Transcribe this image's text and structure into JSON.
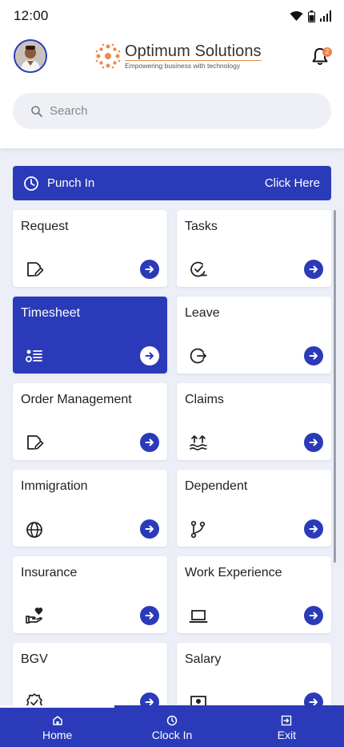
{
  "status_bar": {
    "time": "12:00"
  },
  "header": {
    "logo_title": "Optimum Solutions",
    "logo_tagline": "Empowering business with technology",
    "notification_count": "2"
  },
  "search": {
    "placeholder": "Search"
  },
  "punch": {
    "label": "Punch In",
    "action": "Click Here"
  },
  "cards": [
    {
      "label": "Request",
      "icon": "edit-icon"
    },
    {
      "label": "Tasks",
      "icon": "task-check-icon"
    },
    {
      "label": "Timesheet",
      "icon": "list-icon"
    },
    {
      "label": "Leave",
      "icon": "logout-circle-icon"
    },
    {
      "label": "Order Management",
      "icon": "edit-icon"
    },
    {
      "label": "Claims",
      "icon": "claims-icon"
    },
    {
      "label": "Immigration",
      "icon": "globe-icon"
    },
    {
      "label": "Dependent",
      "icon": "branch-icon"
    },
    {
      "label": "Insurance",
      "icon": "hand-heart-icon"
    },
    {
      "label": "Work Experience",
      "icon": "laptop-icon"
    },
    {
      "label": "BGV",
      "icon": "verified-badge-icon"
    },
    {
      "label": "Salary",
      "icon": "wallet-icon"
    }
  ],
  "bottom_nav": [
    {
      "label": "Home",
      "icon": "home-icon"
    },
    {
      "label": "Clock In",
      "icon": "clock-icon"
    },
    {
      "label": "Exit",
      "icon": "exit-icon"
    }
  ],
  "colors": {
    "primary": "#2a3ab8",
    "accent": "#f0824e",
    "background": "#eceef8"
  }
}
